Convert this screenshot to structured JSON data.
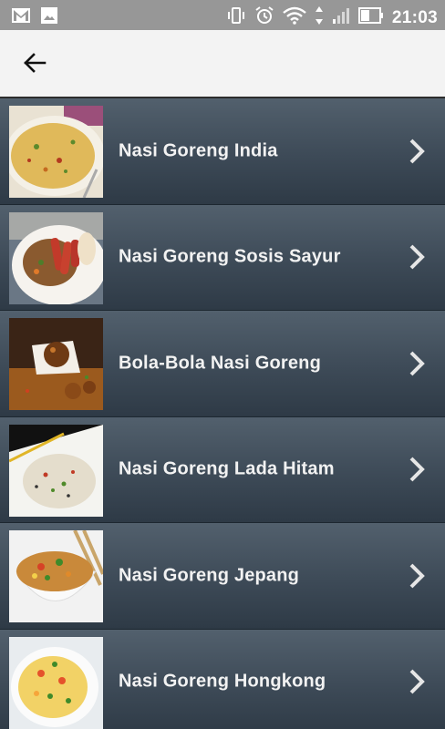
{
  "status_bar": {
    "time": "21:03",
    "icons": [
      "gmail-icon",
      "image-icon",
      "vibrate-icon",
      "alarm-icon",
      "wifi-icon",
      "signal-icon",
      "battery-icon"
    ]
  },
  "app_bar": {
    "back_icon": "arrow-left-icon"
  },
  "recipes": [
    {
      "label": "Nasi Goreng India",
      "thumb": "nasi-goreng-india-photo"
    },
    {
      "label": "Nasi Goreng Sosis Sayur",
      "thumb": "nasi-goreng-sosis-sayur-photo"
    },
    {
      "label": "Bola-Bola Nasi Goreng",
      "thumb": "bola-bola-nasi-goreng-photo"
    },
    {
      "label": "Nasi Goreng Lada Hitam",
      "thumb": "nasi-goreng-lada-hitam-photo"
    },
    {
      "label": "Nasi Goreng Jepang",
      "thumb": "nasi-goreng-jepang-photo"
    },
    {
      "label": "Nasi Goreng Hongkong",
      "thumb": "nasi-goreng-hongkong-photo"
    }
  ],
  "colors": {
    "status_bar": "#979797",
    "app_bar": "#f3f3f3",
    "list_top": "#52606d",
    "list_bottom": "#2e3a46",
    "label": "#f2f2f2"
  }
}
